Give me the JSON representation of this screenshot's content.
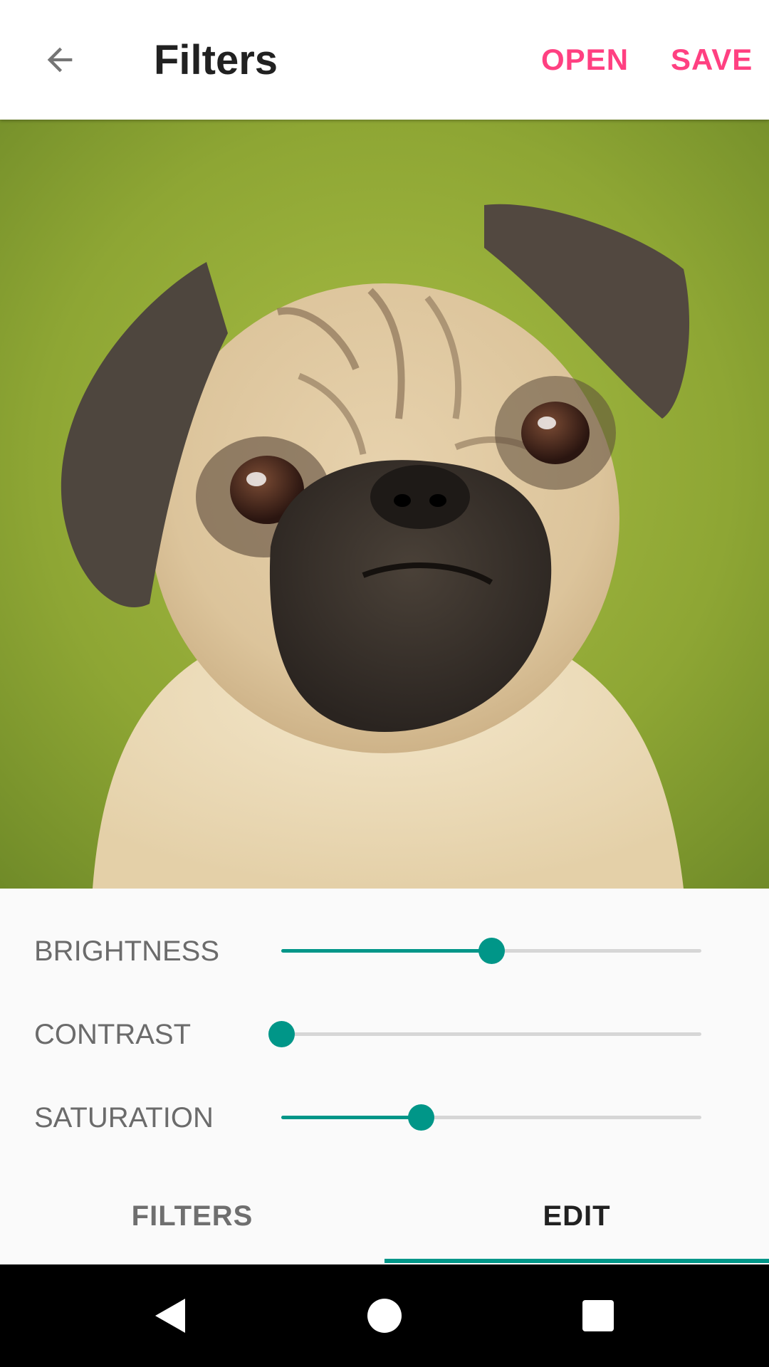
{
  "toolbar": {
    "title": "Filters",
    "back_icon": "arrow-back-icon",
    "actions": {
      "open": "OPEN",
      "save": "SAVE"
    },
    "accent_color": "#ff4081"
  },
  "photo": {
    "subject": "pug-photo"
  },
  "sliders": {
    "accent_color": "#009688",
    "brightness": {
      "label": "BRIGHTNESS",
      "value": 0.5
    },
    "contrast": {
      "label": "CONTRAST",
      "value": 0.0
    },
    "saturation": {
      "label": "SATURATION",
      "value": 0.333
    }
  },
  "tabs": {
    "items": [
      {
        "label": "FILTERS",
        "selected": false
      },
      {
        "label": "EDIT",
        "selected": true
      }
    ]
  },
  "navbar": {
    "icons": [
      "nav-back-icon",
      "nav-home-icon",
      "nav-recents-icon"
    ]
  }
}
